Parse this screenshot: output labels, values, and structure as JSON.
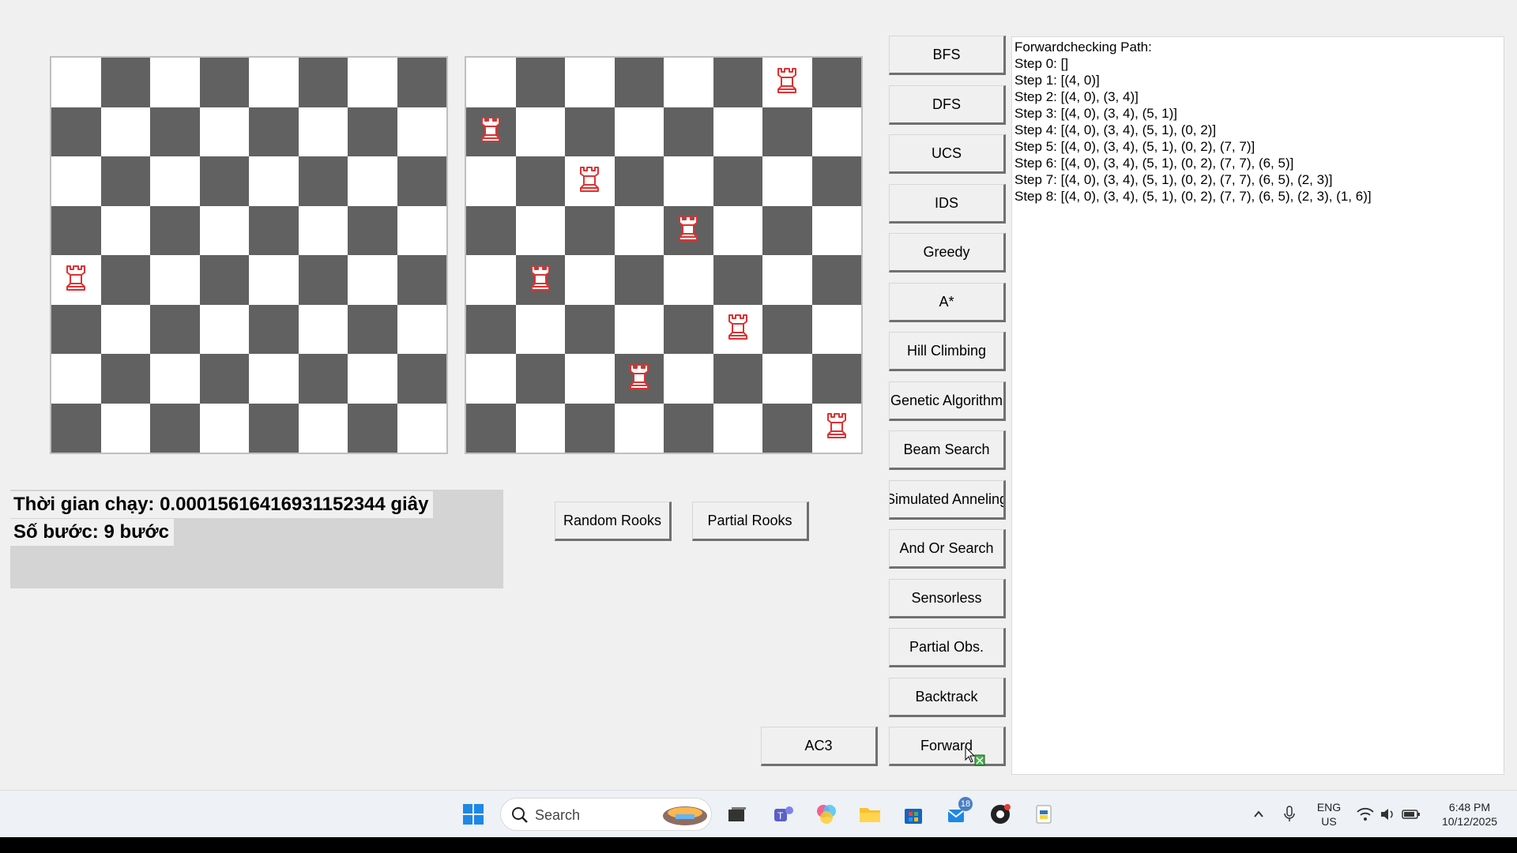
{
  "boards": {
    "left": {
      "rook_rows_by_column": [
        4,
        null,
        null,
        null,
        null,
        null,
        null,
        null
      ]
    },
    "right": {
      "rook_rows_by_column": [
        1,
        4,
        2,
        6,
        3,
        5,
        0,
        7
      ]
    }
  },
  "info": {
    "run_time": "Thời gian chạy: 0.00015616416931152344 giây",
    "steps": "Số bước: 9 bước"
  },
  "buttons": {
    "random_rooks": "Random Rooks",
    "partial_rooks": "Partial Rooks",
    "ac3": "AC3",
    "algorithms": [
      "BFS",
      "DFS",
      "UCS",
      "IDS",
      "Greedy",
      "A*",
      "Hill Climbing",
      "Genetic Algorithm",
      "Beam Search",
      "Simulated Anneling",
      "And Or Search",
      "Sensorless",
      "Partial Obs.",
      "Backtrack",
      "Forward"
    ]
  },
  "output": {
    "lines": [
      "Forwardchecking Path:",
      "Step 0: []",
      "Step 1: [(4, 0)]",
      "Step 2: [(4, 0), (3, 4)]",
      "Step 3: [(4, 0), (3, 4), (5, 1)]",
      "Step 4: [(4, 0), (3, 4), (5, 1), (0, 2)]",
      "Step 5: [(4, 0), (3, 4), (5, 1), (0, 2), (7, 7)]",
      "Step 6: [(4, 0), (3, 4), (5, 1), (0, 2), (7, 7), (6, 5)]",
      "Step 7: [(4, 0), (3, 4), (5, 1), (0, 2), (7, 7), (6, 5), (2, 3)]",
      "Step 8: [(4, 0), (3, 4), (5, 1), (0, 2), (7, 7), (6, 5), (2, 3), (1, 6)]"
    ]
  },
  "taskbar": {
    "search_label": "Search",
    "language": "ENG",
    "region": "US",
    "time": "6:48 PM",
    "date": "10/12/2025",
    "notification_count": "18"
  },
  "colors": {
    "dark_square": "#616161",
    "light_square": "#ffffff",
    "rook": "#e03131"
  }
}
